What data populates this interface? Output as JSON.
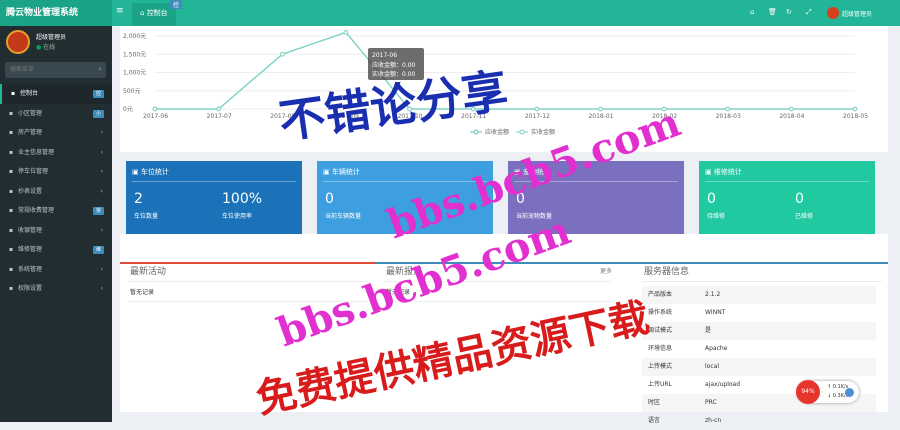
{
  "app": {
    "title": "腾云物业管理系统"
  },
  "topbar": {
    "menu_icon": "hamburger-icon",
    "home_tab": "控制台",
    "tab_badge": "控",
    "icons": [
      "home-icon",
      "trash-icon",
      "refresh-icon",
      "expand-icon"
    ],
    "user_name": "超级管理员"
  },
  "sidebar": {
    "profile": {
      "name": "超级管理员",
      "status": "在线"
    },
    "search": {
      "placeholder": "搜索菜单"
    },
    "items": [
      {
        "label": "控制台",
        "icon": "dashboard-icon",
        "badge": "控",
        "active": true
      },
      {
        "label": "小区管理",
        "icon": "building-icon",
        "badge": "小"
      },
      {
        "label": "房产管理",
        "icon": "house-icon",
        "chevron": "‹"
      },
      {
        "label": "业主信息管理",
        "icon": "user-icon",
        "chevron": "‹"
      },
      {
        "label": "停车位管理",
        "icon": "car-icon",
        "chevron": "‹"
      },
      {
        "label": "抄表设置",
        "icon": "meter-icon",
        "chevron": "‹"
      },
      {
        "label": "常规收费管理",
        "icon": "money-icon",
        "badge": "常"
      },
      {
        "label": "收银管理",
        "icon": "cashier-icon",
        "chevron": "‹"
      },
      {
        "label": "维修管理",
        "icon": "wrench-icon",
        "badge": "维"
      },
      {
        "label": "系统管理",
        "icon": "gear-icon",
        "chevron": "‹"
      },
      {
        "label": "权限设置",
        "icon": "lock-icon",
        "chevron": "‹"
      }
    ]
  },
  "chart_data": {
    "type": "line",
    "x": [
      "2017-06",
      "2017-07",
      "2017-08",
      "2017-09",
      "2017-10",
      "2017-11",
      "2017-12",
      "2018-01",
      "2018-02",
      "2018-03",
      "2018-04",
      "2018-05"
    ],
    "y_ticks": [
      "2,000元",
      "1,500元",
      "1,000元",
      "500元",
      "0元"
    ],
    "ylim": [
      0,
      2000
    ],
    "series": [
      {
        "name": "应收金额",
        "values": [
          0,
          0,
          1500,
          2100,
          0,
          0,
          0,
          0,
          0,
          0,
          0,
          0
        ],
        "color": "#5ec4b6"
      },
      {
        "name": "实收金额",
        "values": [
          0,
          0,
          1500,
          2100,
          0,
          0,
          0,
          0,
          0,
          0,
          0,
          0
        ],
        "color": "#7fd1c5"
      }
    ],
    "tooltip": {
      "title": "2017-06",
      "line1": "应收金额：0.00",
      "line2": "实收金额：0.00"
    },
    "legend_position": "bottom-center"
  },
  "stats": [
    {
      "title": "车位统计",
      "icon": "parking-icon",
      "color": "#1b72b8",
      "cols": [
        {
          "value": "2",
          "label": "车位数量"
        },
        {
          "value": "100%",
          "label": "车位使用率"
        }
      ]
    },
    {
      "title": "车辆统计",
      "icon": "truck-icon",
      "color": "#3d9fe0",
      "cols": [
        {
          "value": "0",
          "label": "当前车辆数量"
        }
      ]
    },
    {
      "title": "宠物统计",
      "icon": "heart-icon",
      "color": "#7b70c0",
      "cols": [
        {
          "value": "0",
          "label": "当前宠物数量"
        }
      ]
    },
    {
      "title": "维修统计",
      "icon": "wrench-icon",
      "color": "#21c9a1",
      "cols": [
        {
          "value": "0",
          "label": "待维修"
        },
        {
          "value": "0",
          "label": "已维修"
        }
      ]
    }
  ],
  "activity": {
    "title": "最新活动",
    "empty": "暂无记录"
  },
  "repair": {
    "title": "最新报修",
    "more": "更多",
    "empty": "暂无记录"
  },
  "server": {
    "title": "服务器信息",
    "rows": [
      {
        "k": "产品版本",
        "v": "2.1.2"
      },
      {
        "k": "操作系统",
        "v": "WINNT"
      },
      {
        "k": "调试模式",
        "v": "是"
      },
      {
        "k": "环境信息",
        "v": "Apache"
      },
      {
        "k": "上传模式",
        "v": "local"
      },
      {
        "k": "上传URL",
        "v": "ajax/upload"
      },
      {
        "k": "时区",
        "v": "PRC"
      },
      {
        "k": "语言",
        "v": "zh-cn"
      }
    ]
  },
  "toast": {
    "percent": "94%",
    "up": "0.1K/s",
    "down": "0.3K/s"
  },
  "watermark": {
    "line1": "不错论分享",
    "line2": "bbs.bcb5.com",
    "line3": "bbs.bcb5.com",
    "line4": "免费提供精品资源下载"
  }
}
